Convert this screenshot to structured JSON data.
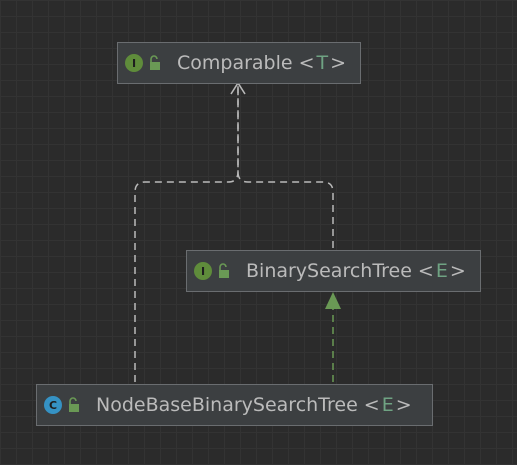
{
  "nodes": {
    "comparable": {
      "kind": "I",
      "name": "Comparable",
      "open": "<",
      "type_param": "T",
      "close": ">"
    },
    "binary_search_tree": {
      "kind": "I",
      "name": "BinarySearchTree",
      "open": "<",
      "type_param": "E",
      "close": ">"
    },
    "node_base_bst": {
      "kind": "C",
      "name": "NodeBaseBinarySearchTree",
      "open": "<",
      "type_param": "E",
      "close": ">"
    }
  },
  "colors": {
    "background": "#2b2b2b",
    "node_fill": "#3c3f41",
    "node_border": "#6a6d70",
    "interface_badge": "#5f8c3b",
    "class_badge": "#3592c4",
    "type_param": "#6fa383",
    "text": "#bbbbbb",
    "dashed_edge": "#b9b9b9",
    "implements_edge": "#6a9955"
  },
  "edges": [
    {
      "from": "binary_search_tree",
      "to": "comparable",
      "style": "dashed",
      "arrow": "open"
    },
    {
      "from": "node_base_bst",
      "to": "comparable",
      "style": "dashed",
      "arrow": "open"
    },
    {
      "from": "node_base_bst",
      "to": "binary_search_tree",
      "style": "dashed-green",
      "arrow": "filled-triangle"
    }
  ]
}
